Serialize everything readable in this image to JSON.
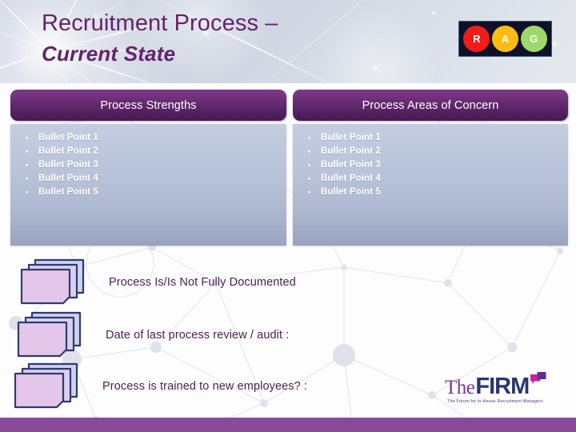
{
  "slide": {
    "title_line1": "Recruitment Process –",
    "title_line2": "Current State"
  },
  "rag_indicator": {
    "lights": [
      {
        "letter": "R",
        "meaning": "red",
        "color": "#f01c18"
      },
      {
        "letter": "A",
        "meaning": "amber",
        "color": "#fcbd12"
      },
      {
        "letter": "G",
        "meaning": "green",
        "color": "#9ed868"
      }
    ],
    "box_color": "#0e1028"
  },
  "columns": [
    {
      "header": "Process Strengths",
      "bullet_mark": "▪",
      "bullets": [
        "Bullet Point 1",
        "Bullet Point 2",
        "Bullet Point 3",
        "Bullet Point 4",
        "Bullet Point 5"
      ]
    },
    {
      "header": "Process Areas of Concern",
      "bullet_mark": "▪",
      "bullets": [
        "Bullet Point 1",
        "Bullet Point 2",
        "Bullet Point 3",
        "Bullet Point 4",
        "Bullet Point 5"
      ]
    }
  ],
  "document_items": [
    {
      "label": "Process Is/Is Not Fully Documented"
    },
    {
      "label": "Date of last process review / audit :"
    },
    {
      "label": "Process is trained to new employees? :"
    }
  ],
  "logo": {
    "word_the": "The",
    "word_firm": "FIRM",
    "tagline": "The Forum for In-House Recruitment Managers"
  },
  "theme": {
    "accent_purple": "#63246b",
    "header_bar_purple": "#6d2f78",
    "panel_blue": "#bcc6db",
    "bottom_bar_purple": "#8a4a9b",
    "doc_fill": "#e3c6ea",
    "doc_stroke": "#2f3a72"
  }
}
